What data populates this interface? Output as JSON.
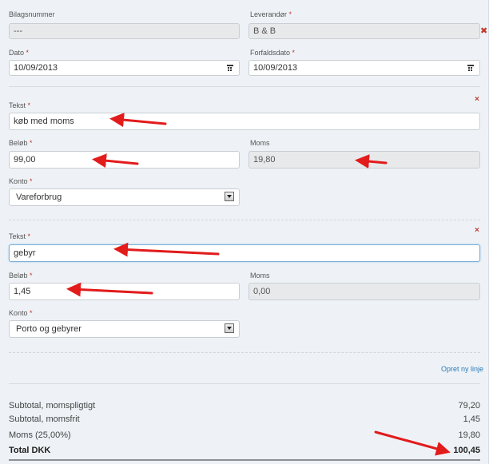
{
  "header": {
    "bilagsnummer": {
      "label": "Bilagsnummer",
      "value": "---"
    },
    "leverandor": {
      "label": "Leverandør",
      "required_mark": "*",
      "value": "B & B"
    },
    "dato": {
      "label": "Dato",
      "required_mark": "*",
      "value": "10/09/2013"
    },
    "forfaldsdato": {
      "label": "Forfaldsdato",
      "required_mark": "*",
      "value": "10/09/2013"
    }
  },
  "lines": [
    {
      "tekst_label": "Tekst",
      "tekst_value": "køb med moms",
      "belob_label": "Beløb",
      "belob_value": "99,00",
      "moms_label": "Moms",
      "moms_value": "19,80",
      "konto_label": "Konto",
      "konto_value": "Vareforbrug",
      "required_mark": "*",
      "remove_icon": "×"
    },
    {
      "tekst_label": "Tekst",
      "tekst_value": "gebyr",
      "belob_label": "Beløb",
      "belob_value": "1,45",
      "moms_label": "Moms",
      "moms_value": "0,00",
      "konto_label": "Konto",
      "konto_value": "Porto og gebyrer",
      "required_mark": "*",
      "remove_icon": "×"
    }
  ],
  "add_line_link": "Opret ny linje",
  "totals": [
    {
      "label": "Subtotal, momspligtigt",
      "value": "79,20"
    },
    {
      "label": "Subtotal, momsfrit",
      "value": "1,45"
    },
    {
      "label": "Moms (25,00%)",
      "value": "19,80"
    },
    {
      "label": "Total DKK",
      "value": "100,45"
    }
  ],
  "icons": {
    "supplier_clear": "✖"
  },
  "colors": {
    "arrow": "#e21b1b",
    "required": "#c0392b",
    "link": "#2a7ab8",
    "background": "#eef2f6"
  }
}
